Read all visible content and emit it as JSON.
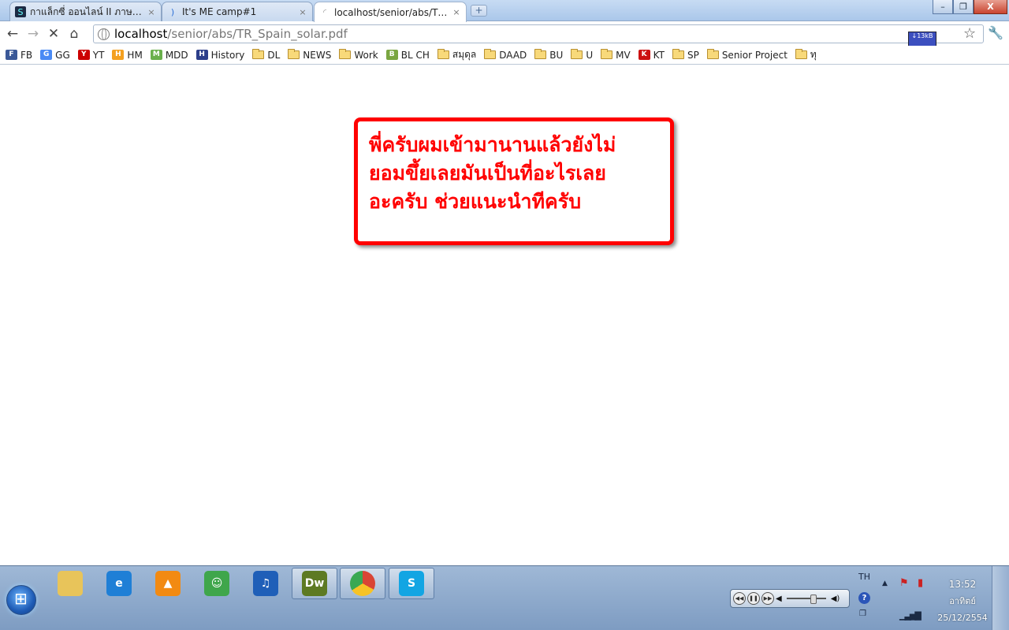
{
  "tabs": [
    {
      "label": "กาแล็กซี่ ออนไลน์ II ภาษาไท...",
      "icon": "galaxy-icon",
      "close": "×"
    },
    {
      "label": "It's ME camp#1",
      "icon": "loading-icon",
      "close": "×"
    },
    {
      "label": "localhost/senior/abs/TR_...",
      "icon": "loading-icon",
      "close": "×"
    }
  ],
  "new_tab": "+",
  "window_controls": {
    "minimize": "–",
    "maximize": "❐",
    "close": "X"
  },
  "address": {
    "host": "localhost",
    "path": "/senior/abs/TR_Spain_solar.pdf"
  },
  "speed_widget": "↓13kB",
  "bookmarks": [
    {
      "label": "FB",
      "icon": "facebook-icon",
      "color": "#3b5998"
    },
    {
      "label": "GG",
      "icon": "google-icon",
      "color": "#4a8af4"
    },
    {
      "label": "YT",
      "icon": "youtube-icon",
      "color": "#cc0000"
    },
    {
      "label": "HM",
      "icon": "hotmail-icon",
      "color": "#f4a020"
    },
    {
      "label": "MDD",
      "icon": "mdd-icon",
      "color": "#6ab04c"
    },
    {
      "label": "History",
      "icon": "history-icon",
      "color": "#2c3e8a"
    },
    {
      "label": "DL",
      "icon": "folder-icon"
    },
    {
      "label": "NEWS",
      "icon": "folder-icon"
    },
    {
      "label": "Work",
      "icon": "folder-icon"
    },
    {
      "label": "BL CH",
      "icon": "flask-icon",
      "color": "#7aa641"
    },
    {
      "label": "สมุดุล",
      "icon": "folder-icon"
    },
    {
      "label": "DAAD",
      "icon": "folder-icon"
    },
    {
      "label": "BU",
      "icon": "folder-icon"
    },
    {
      "label": "U",
      "icon": "folder-icon"
    },
    {
      "label": "MV",
      "icon": "folder-icon"
    },
    {
      "label": "KT",
      "icon": "k-icon",
      "color": "#cc1111"
    },
    {
      "label": "SP",
      "icon": "folder-icon"
    },
    {
      "label": "Senior Project",
      "icon": "folder-icon"
    },
    {
      "label": "ทุ",
      "icon": "folder-icon"
    }
  ],
  "notice": {
    "lines": [
      "พี่ครับผมเข้ามานานแล้วยังไม่",
      "ยอมขึ้ยเลยมันเป็นที่อะไรเลย",
      "อะครับ ช่วยแนะนำทีครับ"
    ],
    "color": "#ff0000"
  },
  "taskbar": {
    "apps": [
      {
        "name": "explorer",
        "icon": "folder-explorer-icon",
        "label": "",
        "color": "#e8c45a",
        "running": false
      },
      {
        "name": "ie",
        "icon": "internet-explorer-icon",
        "label": "e",
        "color": "#1f7fd6",
        "running": false
      },
      {
        "name": "vlc",
        "icon": "vlc-icon",
        "label": "▲",
        "color": "#f28a12",
        "running": false
      },
      {
        "name": "messenger",
        "icon": "messenger-icon",
        "label": "☺",
        "color": "#3fa64b",
        "running": false
      },
      {
        "name": "itunes",
        "icon": "itunes-icon",
        "label": "♫",
        "color": "#1f5fb8",
        "running": false
      },
      {
        "name": "dreamweaver",
        "icon": "dreamweaver-icon",
        "label": "Dw",
        "color": "#5d7a23",
        "running": true
      },
      {
        "name": "chrome",
        "icon": "chrome-icon",
        "label": "",
        "color": "#d94535",
        "running": true
      },
      {
        "name": "skype",
        "icon": "skype-icon",
        "label": "S",
        "color": "#12a5e3",
        "running": true
      }
    ],
    "lang": "TH",
    "time": "13:52",
    "day": "อาทิตย์",
    "date": "25/12/2554"
  }
}
